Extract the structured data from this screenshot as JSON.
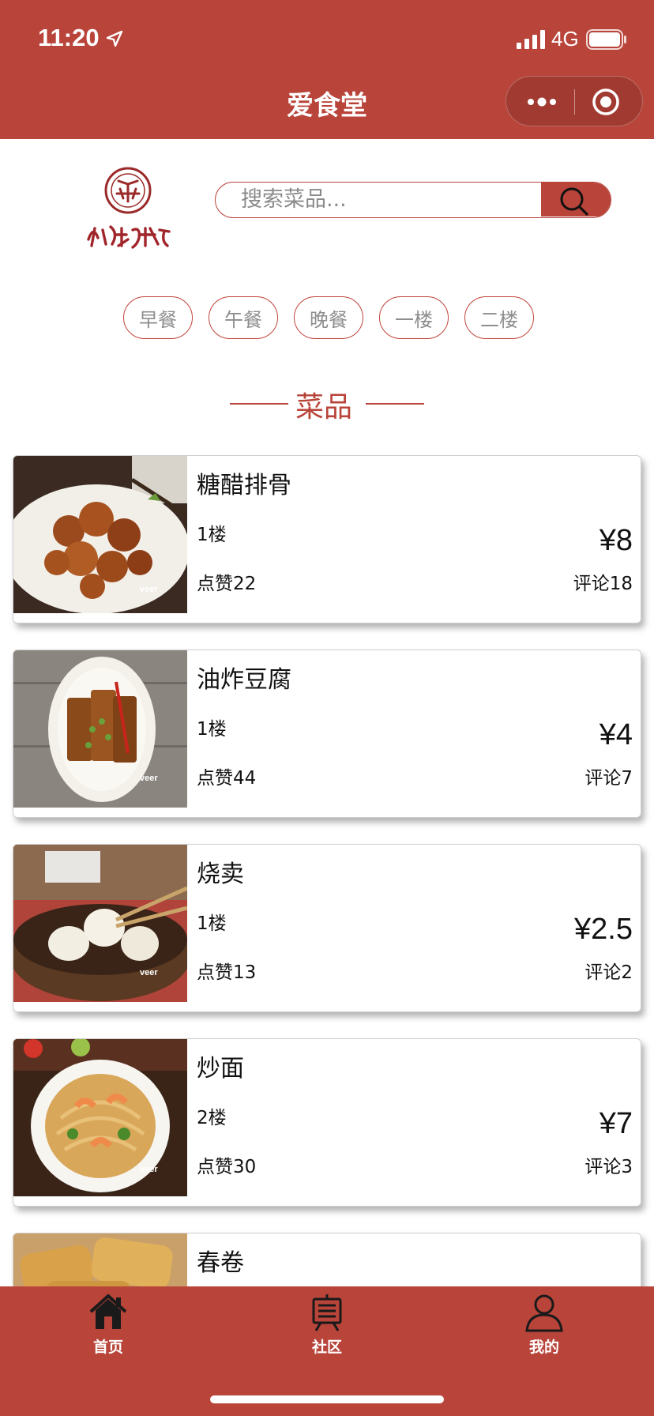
{
  "status_bar": {
    "time": "11:20",
    "network": "4G"
  },
  "nav": {
    "title": "爱食堂"
  },
  "logo": {
    "alt_text": "北京大学"
  },
  "search": {
    "placeholder": "搜索菜品..."
  },
  "filters": [
    "早餐",
    "午餐",
    "晚餐",
    "一楼",
    "二楼"
  ],
  "section": {
    "title": "菜品"
  },
  "dishes": [
    {
      "name": "糖醋排骨",
      "floor": "1楼",
      "likes": "点赞22",
      "price": "¥8",
      "comments": "评论18"
    },
    {
      "name": "油炸豆腐",
      "floor": "1楼",
      "likes": "点赞44",
      "price": "¥4",
      "comments": "评论7"
    },
    {
      "name": "烧卖",
      "floor": "1楼",
      "likes": "点赞13",
      "price": "¥2.5",
      "comments": "评论2"
    },
    {
      "name": "炒面",
      "floor": "2楼",
      "likes": "点赞30",
      "price": "¥7",
      "comments": "评论3"
    },
    {
      "name": "春卷",
      "floor": "",
      "likes": "",
      "price": "",
      "comments": ""
    }
  ],
  "tabbar": {
    "home": "首页",
    "community": "社区",
    "mine": "我的"
  },
  "colors": {
    "brand": "#b8443a",
    "tag_text": "#8d8d8d"
  }
}
